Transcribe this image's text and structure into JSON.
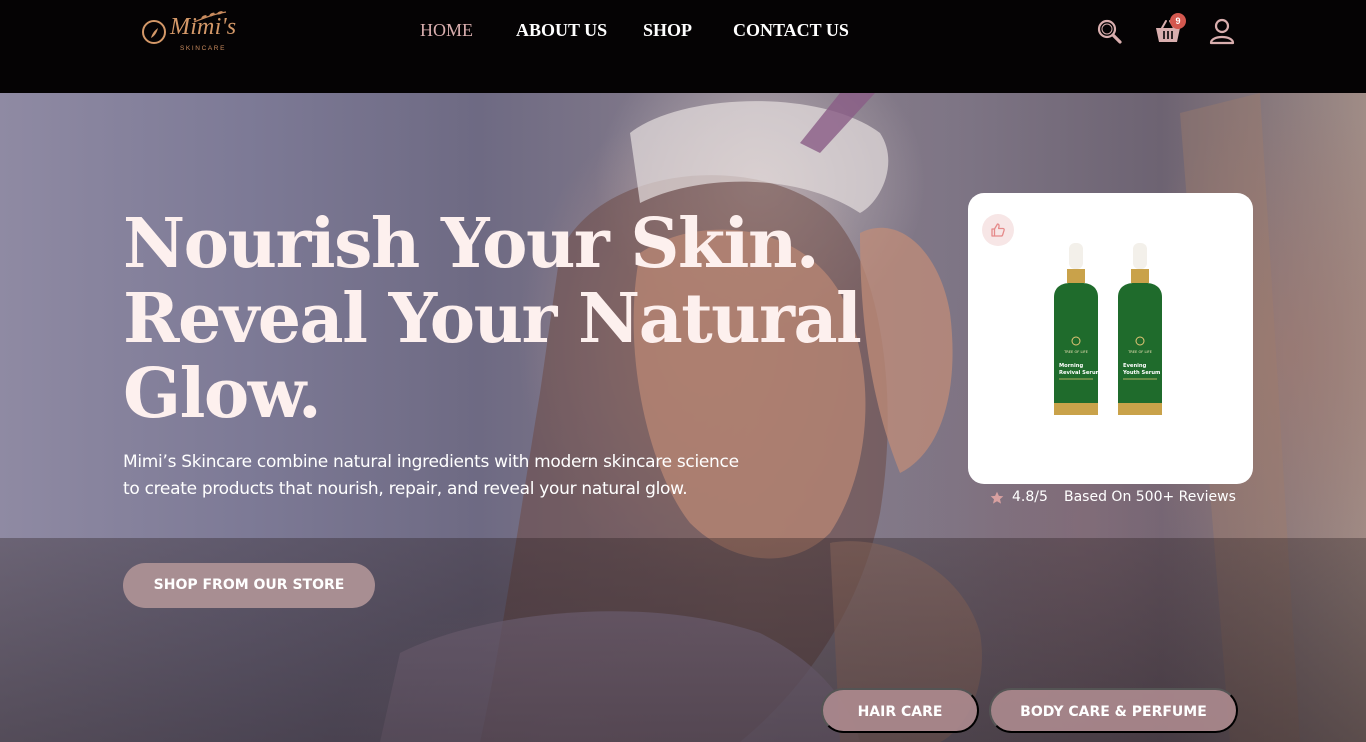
{
  "brand": {
    "name": "Mimi's",
    "tagline": "SKINCARE",
    "accent_color": "#d49868"
  },
  "nav": {
    "items": [
      {
        "label": "HOME",
        "active": true
      },
      {
        "label": "ABOUT US",
        "active": false
      },
      {
        "label": "SHOP",
        "active": false
      },
      {
        "label": "CONTACT US",
        "active": false
      }
    ],
    "active_color": "#d9aeae"
  },
  "header_icons": {
    "search": "search-icon",
    "cart": "cart-icon",
    "cart_count": "9",
    "account": "user-icon"
  },
  "hero": {
    "headline": [
      "Nourish Your Skin.",
      "Reveal Your Natural",
      "Glow."
    ],
    "description": "Mimi’s Skincare combine natural ingredients with modern skincare science to create products that nourish, repair, and reveal your natural glow.",
    "cta_label": "SHOP FROM OUR STORE"
  },
  "featured_product": {
    "like_icon": "thumbs-up-icon",
    "bottle_brand": "TREE OF LIFE",
    "bottles": [
      {
        "name_line1": "Morning",
        "name_line2": "Revival Serum"
      },
      {
        "name_line1": "Evening",
        "name_line2": "Youth Serum"
      }
    ],
    "rating": "4.8/5",
    "reviews_text": "Based On 500+ Reviews",
    "star_icon": "star-icon"
  },
  "categories": [
    {
      "label": "HAIR CARE"
    },
    {
      "label": "BODY CARE & PERFUME"
    }
  ]
}
